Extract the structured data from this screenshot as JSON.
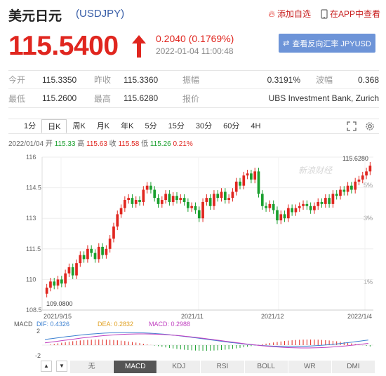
{
  "header": {
    "title": "美元日元",
    "code": "(USDJPY)",
    "link_add": "添加自选",
    "link_app": "在APP中查看"
  },
  "quote": {
    "price": "115.5400",
    "change": "0.2040 (0.1769%)",
    "timestamp": "2022-01-04 11:00:48",
    "reverse_button": "查看反向汇率 JPYUSD"
  },
  "stats": [
    [
      {
        "label": "今开",
        "value": "115.3350"
      },
      {
        "label": "昨收",
        "value": "115.3360"
      },
      {
        "label": "振幅",
        "value": "0.3191%"
      },
      {
        "label": "波幅",
        "value": "0.368"
      }
    ],
    [
      {
        "label": "最低",
        "value": "115.2600"
      },
      {
        "label": "最高",
        "value": "115.6280"
      },
      {
        "label": "报价",
        "value": "UBS Investment Bank, Zurich"
      },
      {
        "label": "",
        "value": ""
      }
    ]
  ],
  "tabs": [
    "1分",
    "日K",
    "周K",
    "月K",
    "年K",
    "5分",
    "15分",
    "30分",
    "60分",
    "4H"
  ],
  "active_tab": "日K",
  "ohlc": {
    "date": "2022/01/04",
    "open_label": "开",
    "open": "115.33",
    "high_label": "高",
    "high": "115.63",
    "close_label": "收",
    "close": "115.58",
    "low_label": "低",
    "low": "115.26",
    "change": "0.21%"
  },
  "watermark": "新浪财经",
  "macd": {
    "label": "MACD",
    "dif": "DIF: 0.4326",
    "dea": "DEA: 0.2832",
    "macd": "MACD: 0.2988",
    "y_top": "2",
    "y_bottom": "-2"
  },
  "indicators": [
    "无",
    "MACD",
    "KDJ",
    "RSI",
    "BOLL",
    "WR",
    "DMI"
  ],
  "active_indicator": "MACD",
  "colors": {
    "up": "#e0261f",
    "down": "#1a9f2e",
    "accent": "#6d94d8"
  },
  "chart_data": {
    "type": "candlestick",
    "y_ticks": [
      "116",
      "114.5",
      "113",
      "111.5",
      "110",
      "108.5"
    ],
    "y_range": [
      108.5,
      116
    ],
    "right_ticks": [
      "5%",
      "3%",
      "1%"
    ],
    "x_ticks": [
      "2021/9/15",
      "2021/11",
      "2021/12",
      "2022/1/4"
    ],
    "max_label": "115.6280",
    "min_label": "109.0800",
    "closes": [
      109.6,
      109.9,
      109.7,
      110.0,
      109.8,
      110.3,
      110.6,
      110.2,
      110.8,
      111.2,
      111.0,
      111.5,
      111.3,
      111.0,
      111.6,
      111.2,
      111.5,
      112.0,
      112.6,
      113.2,
      113.5,
      113.9,
      114.0,
      113.7,
      113.9,
      113.8,
      114.4,
      114.6,
      114.4,
      114.0,
      113.7,
      113.9,
      114.2,
      113.8,
      114.1,
      113.9,
      114.0,
      113.8,
      113.5,
      113.6,
      113.4,
      113.0,
      113.8,
      114.0,
      113.6,
      114.2,
      114.0,
      114.3,
      113.9,
      114.0,
      114.3,
      114.8,
      114.6,
      115.1,
      115.2,
      114.9,
      115.3,
      114.2,
      113.6,
      113.5,
      113.7,
      113.4,
      112.9,
      113.2,
      113.0,
      113.5,
      113.3,
      113.5,
      113.6,
      113.7,
      113.6,
      113.4,
      113.6,
      113.8,
      113.7,
      114.0,
      113.7,
      114.2,
      114.1,
      114.4,
      114.3,
      114.6,
      114.4,
      114.8,
      114.9,
      115.1,
      115.3,
      115.58
    ]
  }
}
